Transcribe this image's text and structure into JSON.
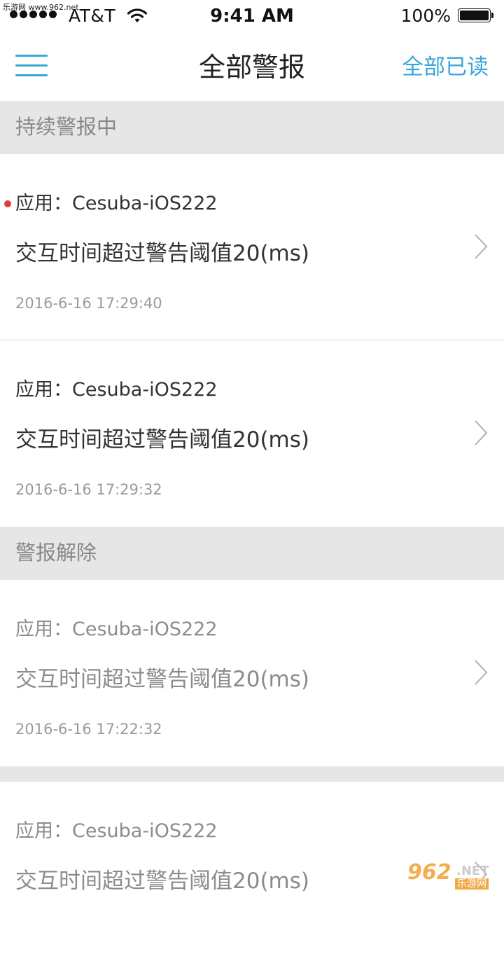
{
  "watermark": {
    "top": "乐游网 www.962.net",
    "logo": "962",
    "logo_suffix": ".NET",
    "logo_cn": "乐游网"
  },
  "status_bar": {
    "carrier": "AT&T",
    "time": "9:41 AM",
    "battery": "100%",
    "icons": [
      "signal-dots-icon",
      "wifi-icon",
      "battery-icon"
    ]
  },
  "nav": {
    "title": "全部警报",
    "mark_all_read": "全部已读",
    "menu_icon": "hamburger-menu-icon"
  },
  "colors": {
    "accent": "#3aa6d8",
    "unread_dot": "#e23a3a",
    "section_bg": "#e6e6e6"
  },
  "sections": [
    {
      "title": "持续警报中",
      "items": [
        {
          "app": "应用：Cesuba-iOS222",
          "message": "交互时间超过警告阈值20(ms)",
          "time": "2016-6-16 17:29:40",
          "unread": true
        },
        {
          "app": "应用：Cesuba-iOS222",
          "message": "交互时间超过警告阈值20(ms)",
          "time": "2016-6-16 17:29:32",
          "unread": false
        }
      ]
    },
    {
      "title": "警报解除",
      "items": [
        {
          "app": "应用：Cesuba-iOS222",
          "message": "交互时间超过警告阈值20(ms)",
          "time": "2016-6-16 17:22:32",
          "unread": false
        },
        {
          "app": "应用：Cesuba-iOS222",
          "message": "交互时间超过警告阈值20(ms)",
          "time": "",
          "unread": false
        }
      ]
    }
  ]
}
